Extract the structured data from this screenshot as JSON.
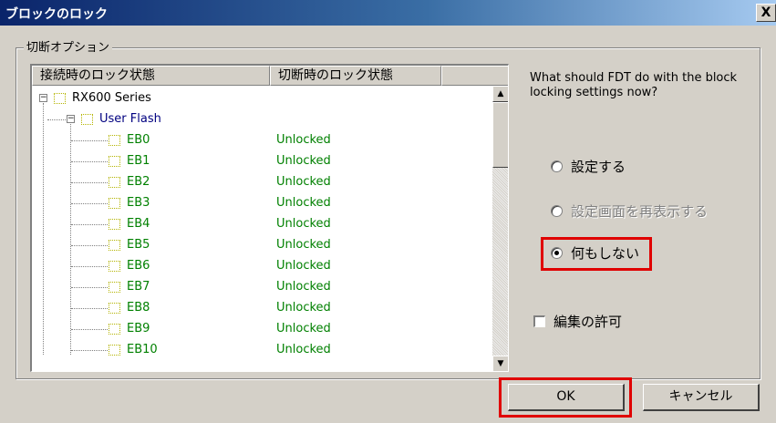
{
  "window": {
    "title": "ブロックのロック",
    "close_label": "X"
  },
  "group": {
    "label": "切断オプション"
  },
  "list": {
    "headers": [
      "接続時のロック状態",
      "切断時のロック状態"
    ],
    "device": "RX600 Series",
    "area": "User Flash",
    "blocks": [
      {
        "name": "EB0",
        "state": "Unlocked"
      },
      {
        "name": "EB1",
        "state": "Unlocked"
      },
      {
        "name": "EB2",
        "state": "Unlocked"
      },
      {
        "name": "EB3",
        "state": "Unlocked"
      },
      {
        "name": "EB4",
        "state": "Unlocked"
      },
      {
        "name": "EB5",
        "state": "Unlocked"
      },
      {
        "name": "EB6",
        "state": "Unlocked"
      },
      {
        "name": "EB7",
        "state": "Unlocked"
      },
      {
        "name": "EB8",
        "state": "Unlocked"
      },
      {
        "name": "EB9",
        "state": "Unlocked"
      },
      {
        "name": "EB10",
        "state": "Unlocked"
      }
    ],
    "colors": {
      "device_text": "#000000",
      "area_text": "#000080",
      "block_text": "#008000"
    }
  },
  "question": "What should FDT do with the block locking settings now?",
  "options": [
    {
      "label": "設定する",
      "selected": false,
      "enabled": true
    },
    {
      "label": "設定画面を再表示する",
      "selected": false,
      "enabled": false
    },
    {
      "label": "何もしない",
      "selected": true,
      "enabled": true
    }
  ],
  "allow_edit": {
    "label": "編集の許可",
    "checked": false
  },
  "buttons": {
    "ok": "OK",
    "cancel": "キャンセル"
  },
  "highlight_color": "#e00000"
}
